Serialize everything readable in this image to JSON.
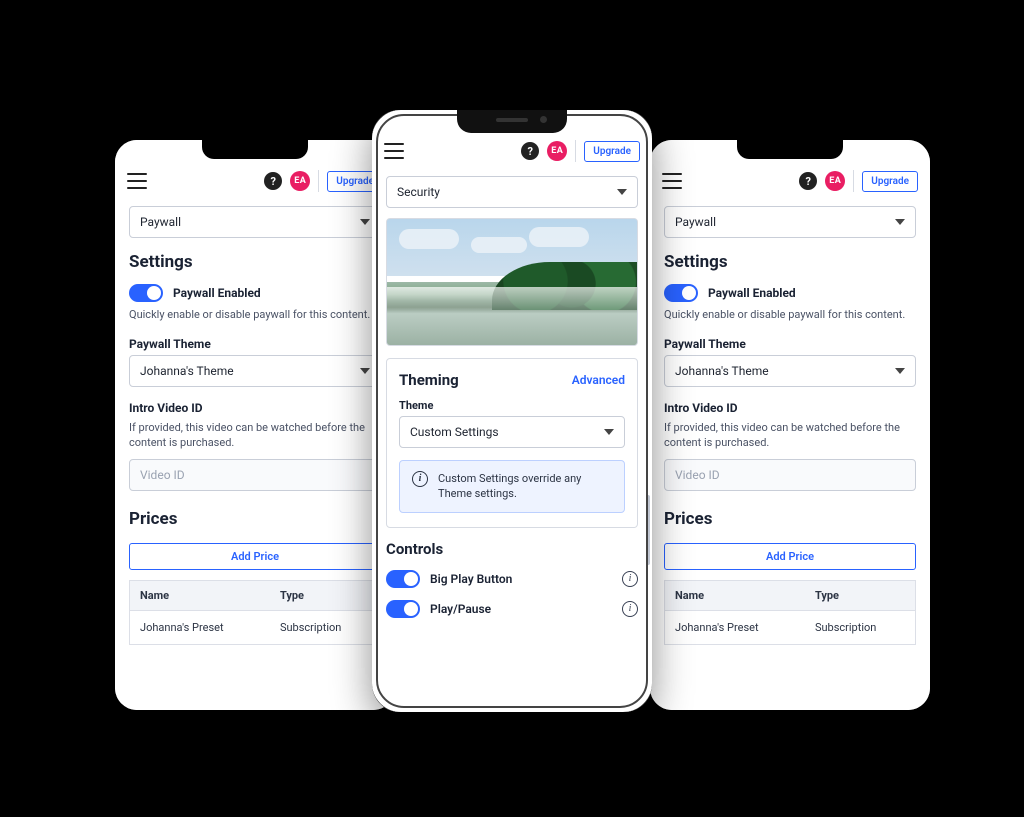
{
  "header": {
    "avatar_initials": "EA",
    "upgrade_label": "Upgrade"
  },
  "side_panel": {
    "section_dropdown": "Paywall",
    "settings_title": "Settings",
    "enable_label": "Paywall Enabled",
    "enable_help": "Quickly enable or disable paywall for this content.",
    "theme_label": "Paywall Theme",
    "theme_value": "Johanna's Theme",
    "intro_label": "Intro Video ID",
    "intro_help": "If provided, this video can be watched before the content is purchased.",
    "intro_placeholder": "Video ID",
    "prices_title": "Prices",
    "add_price": "Add Price",
    "col_name": "Name",
    "col_type": "Type",
    "row_name": "Johanna's Preset",
    "row_type": "Subscription"
  },
  "center_panel": {
    "section_dropdown": "Security",
    "theming_title": "Theming",
    "advanced": "Advanced",
    "theme_label": "Theme",
    "theme_value": "Custom Settings",
    "notice": "Custom Settings override any Theme settings.",
    "controls_title": "Controls",
    "ctl_big_play": "Big Play Button",
    "ctl_play_pause": "Play/Pause"
  }
}
